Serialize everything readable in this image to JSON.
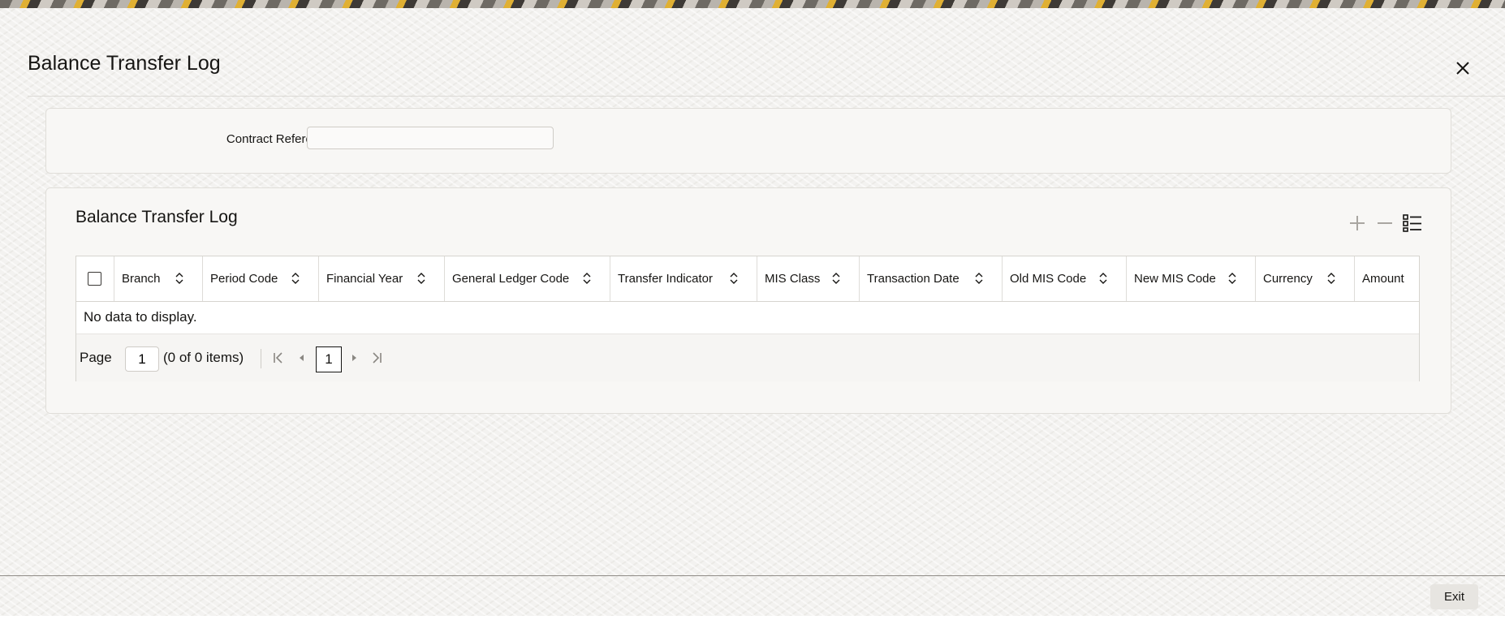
{
  "window": {
    "title": "Balance Transfer Log",
    "close_icon": "close-icon"
  },
  "search": {
    "contract_reference_label": "Contract Reference",
    "contract_reference_value": ""
  },
  "grid": {
    "title": "Balance Transfer Log",
    "toolbar": {
      "add_icon": "plus-icon",
      "remove_icon": "minus-icon",
      "view_icon": "list-view-icon"
    },
    "columns": [
      "Branch",
      "Period Code",
      "Financial Year",
      "General Ledger Code",
      "Transfer Indicator",
      "MIS Class",
      "Transaction Date",
      "Old MIS Code",
      "New MIS Code",
      "Currency",
      "Amount"
    ],
    "empty_message": "No data to display.",
    "pagination": {
      "page_label": "Page",
      "page_input_value": "1",
      "items_count": "(0 of 0 items)",
      "current_page": "1"
    }
  },
  "footer": {
    "exit_label": "Exit"
  },
  "colors": {
    "background": "#f3f2f0",
    "panel": "#f8f7f5",
    "text": "#161513"
  }
}
